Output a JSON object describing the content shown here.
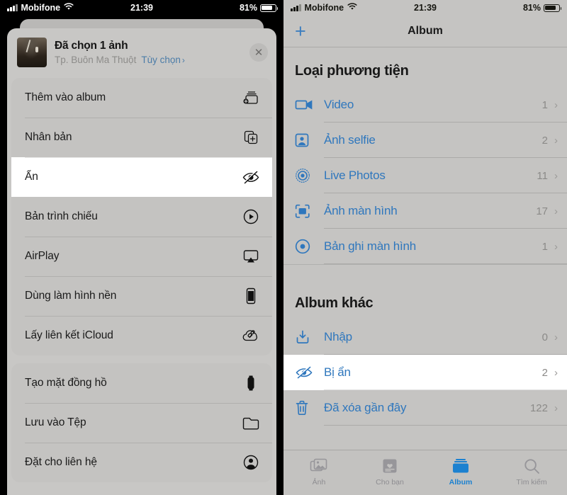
{
  "status_bar": {
    "carrier": "Mobifone",
    "time": "21:39",
    "battery_percent": "81%",
    "wifi_icon": "wifi-icon",
    "signal_icon": "signal-bars-icon",
    "battery_icon": "battery-icon"
  },
  "left_screen": {
    "share_sheet": {
      "title": "Đã chọn 1 ảnh",
      "subtitle": "Tp. Buôn Ma Thuột",
      "options_label": "Tùy chọn",
      "options_chevron": "›",
      "close_icon": "close-icon",
      "thumbnail": "photo-thumbnail",
      "groups": [
        {
          "items": [
            {
              "label": "Thêm vào album",
              "icon": "add-to-album-icon",
              "highlighted": false
            },
            {
              "label": "Nhân bản",
              "icon": "duplicate-icon",
              "highlighted": false
            },
            {
              "label": "Ẩn",
              "icon": "hide-eye-slash-icon",
              "highlighted": true
            },
            {
              "label": "Bản trình chiếu",
              "icon": "slideshow-play-icon",
              "highlighted": false
            },
            {
              "label": "AirPlay",
              "icon": "airplay-icon",
              "highlighted": false
            },
            {
              "label": "Dùng làm hình nền",
              "icon": "wallpaper-phone-icon",
              "highlighted": false
            },
            {
              "label": "Lấy liên kết iCloud",
              "icon": "icloud-link-icon",
              "highlighted": false
            }
          ]
        },
        {
          "items": [
            {
              "label": "Tạo mặt đồng hồ",
              "icon": "watch-face-icon",
              "highlighted": false
            },
            {
              "label": "Lưu vào Tệp",
              "icon": "folder-icon",
              "highlighted": false
            },
            {
              "label": "Đặt cho liên hệ",
              "icon": "contact-person-icon",
              "highlighted": false
            }
          ]
        }
      ]
    }
  },
  "right_screen": {
    "nav": {
      "add_icon": "plus-icon",
      "title": "Album"
    },
    "sections": [
      {
        "title": "Loại phương tiện",
        "items": [
          {
            "label": "Video",
            "count": "1",
            "icon": "video-camera-icon",
            "chevron": "›",
            "highlighted": false
          },
          {
            "label": "Ảnh selfie",
            "count": "2",
            "icon": "selfie-person-icon",
            "chevron": "›",
            "highlighted": false
          },
          {
            "label": "Live Photos",
            "count": "11",
            "icon": "live-photo-icon",
            "chevron": "›",
            "highlighted": false
          },
          {
            "label": "Ảnh màn hình",
            "count": "17",
            "icon": "screenshot-icon",
            "chevron": "›",
            "highlighted": false
          },
          {
            "label": "Bản ghi màn hình",
            "count": "1",
            "icon": "screen-record-icon",
            "chevron": "›",
            "highlighted": false
          }
        ]
      },
      {
        "title": "Album khác",
        "items": [
          {
            "label": "Nhập",
            "count": "0",
            "icon": "import-download-icon",
            "chevron": "›",
            "highlighted": false
          },
          {
            "label": "Bị ẩn",
            "count": "2",
            "icon": "hidden-eye-slash-icon",
            "chevron": "›",
            "highlighted": true
          },
          {
            "label": "Đã xóa gần đây",
            "count": "122",
            "icon": "trash-icon",
            "chevron": "›",
            "highlighted": false
          }
        ]
      }
    ],
    "tabs": [
      {
        "label": "Ảnh",
        "icon": "photos-icon",
        "active": false
      },
      {
        "label": "Cho bạn",
        "icon": "for-you-icon",
        "active": false
      },
      {
        "label": "Album",
        "icon": "albums-icon",
        "active": true
      },
      {
        "label": "Tìm kiếm",
        "icon": "search-icon",
        "active": false
      }
    ]
  },
  "colors": {
    "accent_blue": "#2f77bd",
    "tab_active": "#1c81d0",
    "sheet_bg": "#c8c7c5",
    "row_bg": "#c4c3c1",
    "highlight": "#ffffff"
  }
}
